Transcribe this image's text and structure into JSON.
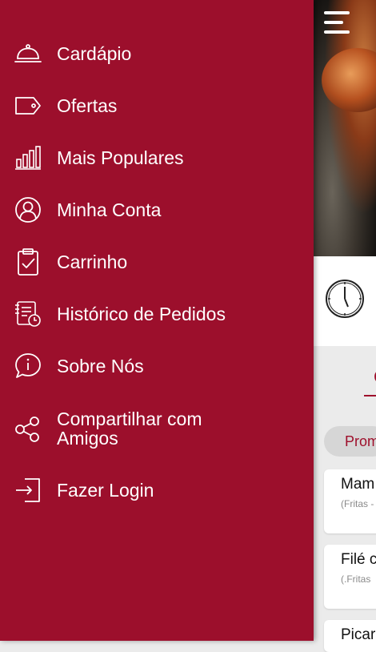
{
  "menu": {
    "items": [
      {
        "label": "Cardápio",
        "icon": "cloche-icon"
      },
      {
        "label": "Ofertas",
        "icon": "tag-icon"
      },
      {
        "label": "Mais Populares",
        "icon": "bar-chart-icon"
      },
      {
        "label": "Minha Conta",
        "icon": "user-icon"
      },
      {
        "label": "Carrinho",
        "icon": "clipboard-check-icon"
      },
      {
        "label": "Histórico de Pedidos",
        "icon": "order-history-icon"
      },
      {
        "label": "Sobre Nós",
        "icon": "info-bubble-icon"
      },
      {
        "label": "Compartilhar com",
        "label_line2": "Amigos",
        "icon": "share-icon"
      },
      {
        "label": "Fazer Login",
        "icon": "login-icon"
      }
    ]
  },
  "background": {
    "tab_letter": "C",
    "promo_pill": "Prom",
    "cards": [
      {
        "name": "Mam",
        "desc": "(Fritas -"
      },
      {
        "name": "Filé c",
        "desc": "(.Fritas"
      },
      {
        "name": "Picar",
        "desc": ""
      }
    ]
  },
  "colors": {
    "drawer": "#9c0f2c",
    "accent": "#9e0f2b",
    "text": "#ffffff"
  }
}
